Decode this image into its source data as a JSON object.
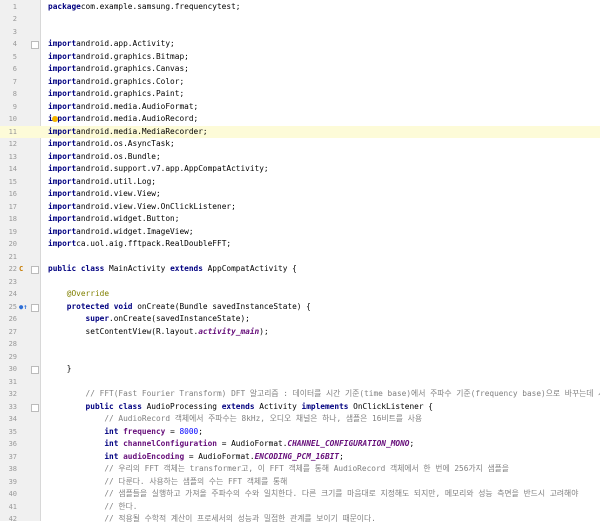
{
  "lines": [
    {
      "n": "1",
      "segs": [
        [
          "kw",
          "package"
        ],
        [
          "",
          "com.example.samsung.frequencytest;"
        ]
      ]
    },
    {
      "n": "2",
      "segs": []
    },
    {
      "n": "3",
      "segs": []
    },
    {
      "n": "4",
      "segs": [
        [
          "kw",
          "import"
        ],
        [
          "",
          "android.app.Activity;"
        ]
      ]
    },
    {
      "n": "5",
      "segs": [
        [
          "kw",
          "import"
        ],
        [
          "",
          "android.graphics.Bitmap;"
        ]
      ]
    },
    {
      "n": "6",
      "segs": [
        [
          "kw",
          "import"
        ],
        [
          "",
          "android.graphics.Canvas;"
        ]
      ]
    },
    {
      "n": "7",
      "segs": [
        [
          "kw",
          "import"
        ],
        [
          "",
          "android.graphics.Color;"
        ]
      ]
    },
    {
      "n": "8",
      "segs": [
        [
          "kw",
          "import"
        ],
        [
          "",
          "android.graphics.Paint;"
        ]
      ]
    },
    {
      "n": "9",
      "segs": [
        [
          "kw",
          "import"
        ],
        [
          "",
          "android.media.AudioFormat;"
        ]
      ]
    },
    {
      "n": "10",
      "segs": [
        [
          "kw",
          "import"
        ],
        [
          "",
          "android.media.AudioRecord;"
        ]
      ]
    },
    {
      "n": "11",
      "hl": "1",
      "segs": [
        [
          "kw",
          "import"
        ],
        [
          "",
          "android.media.MediaRecorder;"
        ]
      ]
    },
    {
      "n": "12",
      "segs": [
        [
          "kw",
          "import"
        ],
        [
          "",
          "android.os.AsyncTask;"
        ]
      ]
    },
    {
      "n": "13",
      "segs": [
        [
          "kw",
          "import"
        ],
        [
          "",
          "android.os.Bundle;"
        ]
      ]
    },
    {
      "n": "14",
      "segs": [
        [
          "kw",
          "import"
        ],
        [
          "",
          "android.support.v7.app.AppCompatActivity;"
        ]
      ]
    },
    {
      "n": "15",
      "segs": [
        [
          "kw",
          "import"
        ],
        [
          "",
          "android.util.Log;"
        ]
      ]
    },
    {
      "n": "16",
      "segs": [
        [
          "kw",
          "import"
        ],
        [
          "",
          "android.view.View;"
        ]
      ]
    },
    {
      "n": "17",
      "segs": [
        [
          "kw",
          "import"
        ],
        [
          "",
          "android.view.View.OnClickListener;"
        ]
      ]
    },
    {
      "n": "18",
      "segs": [
        [
          "kw",
          "import"
        ],
        [
          "",
          "android.widget.Button;"
        ]
      ]
    },
    {
      "n": "19",
      "segs": [
        [
          "kw",
          "import"
        ],
        [
          "",
          "android.widget.ImageView;"
        ]
      ]
    },
    {
      "n": "20",
      "segs": [
        [
          "kw",
          "import"
        ],
        [
          "",
          "ca.uol.aig.fftpack.RealDoubleFFT;"
        ]
      ]
    },
    {
      "n": "21",
      "segs": []
    },
    {
      "n": "22",
      "segs": [
        [
          "kw",
          "public class"
        ],
        [
          "",
          " MainActivity "
        ],
        [
          "kw",
          "extends"
        ],
        [
          "",
          " AppCompatActivity {"
        ]
      ]
    },
    {
      "n": "23",
      "segs": []
    },
    {
      "n": "24",
      "segs": [
        [
          "an",
          "    @Override"
        ]
      ]
    },
    {
      "n": "25",
      "segs": [
        [
          "kw",
          "    protected void"
        ],
        [
          "",
          " onCreate(Bundle savedInstanceState) {"
        ]
      ]
    },
    {
      "n": "26",
      "segs": [
        [
          "kw",
          "        super"
        ],
        [
          "",
          ".onCreate(savedInstanceState);"
        ]
      ]
    },
    {
      "n": "27",
      "segs": [
        [
          "",
          "        setContentView(R.layout."
        ],
        [
          "fld",
          "activity_main"
        ],
        [
          "",
          ");"
        ]
      ]
    },
    {
      "n": "28",
      "segs": []
    },
    {
      "n": "29",
      "segs": []
    },
    {
      "n": "30",
      "segs": [
        [
          "",
          "    }"
        ]
      ]
    },
    {
      "n": "31",
      "segs": []
    },
    {
      "n": "32",
      "segs": [
        [
          "cm",
          "        // FFT(Fast Fourier Transform) DFT 알고리즘 : 데이터를 시간 기준(time base)에서 주파수 기준(frequency base)으로 바꾸는데 사용."
        ]
      ]
    },
    {
      "n": "33",
      "segs": [
        [
          "kw",
          "        public class"
        ],
        [
          "",
          " AudioProcessing "
        ],
        [
          "kw",
          "extends"
        ],
        [
          "",
          " Activity "
        ],
        [
          "kw",
          "implements"
        ],
        [
          "",
          " OnClickListener {"
        ]
      ]
    },
    {
      "n": "34",
      "segs": [
        [
          "cm",
          "            // AudioRecord 객체에서 주파수는 8kHz, 오디오 채널은 하나, 샘플은 16비트를 사용"
        ]
      ]
    },
    {
      "n": "35",
      "segs": [
        [
          "kw",
          "            int"
        ],
        [
          "pf",
          " frequency"
        ],
        [
          "",
          " = "
        ],
        [
          "num",
          "8000"
        ],
        [
          "",
          ";"
        ]
      ]
    },
    {
      "n": "36",
      "segs": [
        [
          "kw",
          "            int"
        ],
        [
          "pf",
          " channelConfiguration"
        ],
        [
          "",
          " = AudioFormat."
        ],
        [
          "fld",
          "CHANNEL_CONFIGURATION_MONO"
        ],
        [
          "",
          ";"
        ]
      ]
    },
    {
      "n": "37",
      "segs": [
        [
          "kw",
          "            int"
        ],
        [
          "pf",
          " audioEncoding"
        ],
        [
          "",
          " = AudioFormat."
        ],
        [
          "fld",
          "ENCODING_PCM_16BIT"
        ],
        [
          "",
          ";"
        ]
      ]
    },
    {
      "n": "38",
      "segs": [
        [
          "cm",
          "            // 우리의 FFT 객체는 transformer고, 이 FFT 객체를 통해 AudioRecord 객체에서 한 번에 256가지 샘플을"
        ]
      ]
    },
    {
      "n": "39",
      "segs": [
        [
          "cm",
          "            // 다룬다. 사용하는 샘플의 수는 FFT 객체를 통해"
        ]
      ]
    },
    {
      "n": "40",
      "segs": [
        [
          "cm",
          "            // 샘플들을 실행하고 가져올 주파수의 수와 일치한다. 다른 크기를 마음대로 지정해도 되지만, 메모리와 성능 측면을 반드시 고려해야"
        ]
      ]
    },
    {
      "n": "41",
      "segs": [
        [
          "cm",
          "            // 한다."
        ]
      ]
    },
    {
      "n": "42",
      "segs": [
        [
          "cm",
          "            // 적용될 수학적 계산이 프로세서의 성능과 밀접한 관계를 보이기 때문이다."
        ]
      ]
    }
  ],
  "gutter_marks": [
    {
      "line": "22",
      "icon": "class-icon",
      "glyph": "C",
      "color": "#c77c02"
    },
    {
      "line": "25",
      "icon": "override-icon",
      "glyph": "●↑",
      "color": "#2f6fd6"
    }
  ],
  "intention_mark": {
    "line": "10",
    "icon": "lightbulb-icon",
    "glyph": "💡"
  }
}
